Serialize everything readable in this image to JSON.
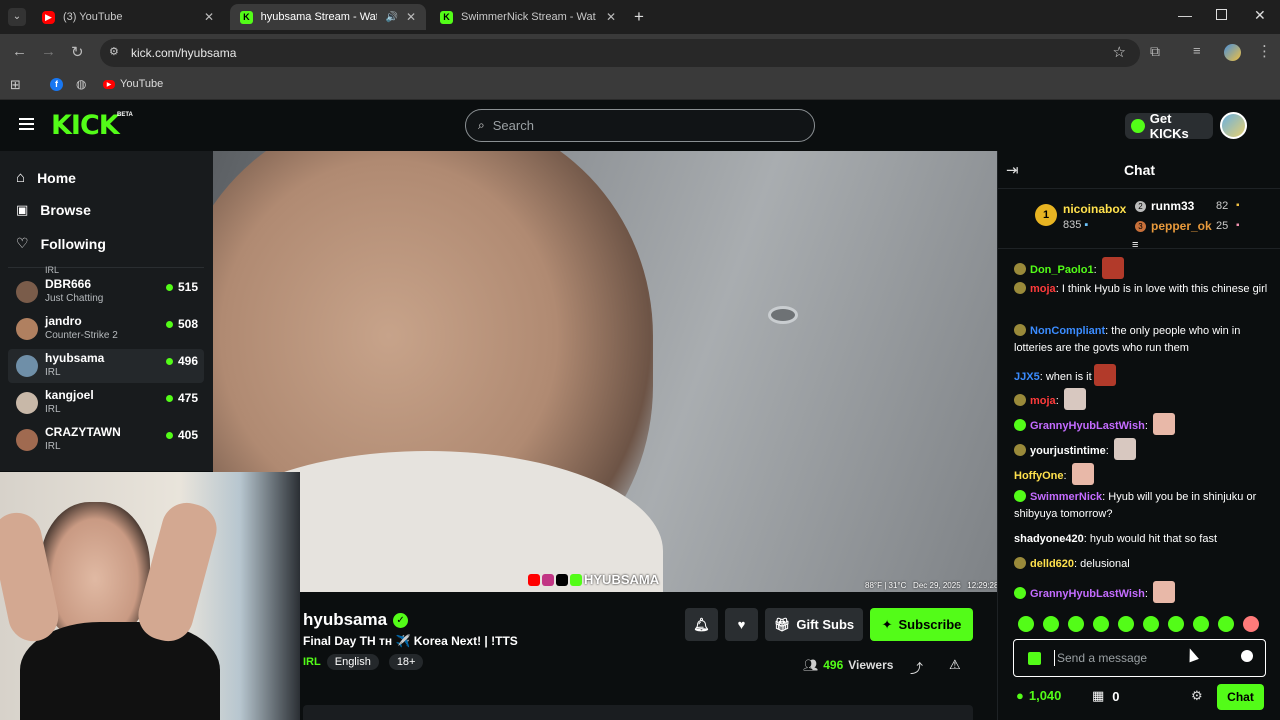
{
  "browser": {
    "tabs": [
      {
        "title": "(3) YouTube",
        "active": false
      },
      {
        "title": "hyubsama Stream - Watch L",
        "active": true
      },
      {
        "title": "SwimmerNick Stream - Watch L",
        "active": false
      }
    ],
    "url": "kick.com/hyubsama",
    "bookmarks": [
      {
        "label": "YouTube"
      }
    ]
  },
  "header": {
    "logo": "KICK",
    "beta": "BETA",
    "search_placeholder": "Search",
    "get_kicks": "Get KICKs"
  },
  "sidebar": {
    "nav": [
      {
        "label": "Home",
        "icon": "home-icon"
      },
      {
        "label": "Browse",
        "icon": "browse-icon"
      },
      {
        "label": "Following",
        "icon": "heart-icon"
      }
    ],
    "partial_top": "IRL",
    "channels": [
      {
        "name": "DBR666",
        "category": "Just Chatting",
        "viewers": "515",
        "active": false,
        "avatar": "#7a5c4a"
      },
      {
        "name": "jandro",
        "category": "Counter-Strike 2",
        "viewers": "508",
        "active": false,
        "avatar": "#b08060"
      },
      {
        "name": "hyubsama",
        "category": "IRL",
        "viewers": "496",
        "active": true,
        "avatar": "#6f8fa8"
      },
      {
        "name": "kangjoel",
        "category": "IRL",
        "viewers": "475",
        "active": false,
        "avatar": "#c8b8a8"
      },
      {
        "name": "CRAZYTAWN",
        "category": "IRL",
        "viewers": "405",
        "active": false,
        "avatar": "#a06a50"
      }
    ]
  },
  "video": {
    "watermark": "HYUBSAMA",
    "overlay_info": "88°F | 31°C   Dec 29, 2025   12:29:28"
  },
  "stream": {
    "channel": "hyubsama",
    "title": "Final Day TH ᴛʜ ✈️ Korea Next! | !TTS",
    "category": "IRL",
    "tags": [
      "English",
      "18+"
    ],
    "viewers_count": "496",
    "viewers_label": "Viewers",
    "gift_subs": "Gift Subs",
    "subscribe": "Subscribe"
  },
  "chat": {
    "title": "Chat",
    "leaderboard": {
      "first": {
        "rank": "1",
        "name": "nicoinabox",
        "score": "835"
      },
      "second": {
        "rank": "2",
        "name": "runm33",
        "score": "82"
      },
      "third": {
        "rank": "3",
        "name": "pepper_ok",
        "score": "25"
      }
    },
    "messages": [
      {
        "user": "Don_Paolo1",
        "color": "#53fc18",
        "text": "",
        "emote": "#b23a2a",
        "badge": "#9a8a3a"
      },
      {
        "user": "moja",
        "color": "#ff3b3b",
        "text": "I think Hyub is in love with this chinese girl",
        "emote": "",
        "badge": "#9a8a3a"
      },
      {
        "user": "NonCompliant",
        "color": "#3b8cff",
        "text": "the only people who win in lotteries are the govts who run them",
        "emote": "",
        "badge": "#9a8a3a"
      },
      {
        "user": "JJX5",
        "color": "#3b8cff",
        "text": "when is it",
        "emote": "#b23a2a",
        "badge": ""
      },
      {
        "user": "moja",
        "color": "#ff3b3b",
        "text": "",
        "emote": "#d8c8c0",
        "badge": "#9a8a3a"
      },
      {
        "user": "GrannyHyubLastWish",
        "color": "#c46cff",
        "text": "",
        "emote": "#e8b8a8",
        "badge": "#53fc18"
      },
      {
        "user": "yourjustintime",
        "color": "#ffffff",
        "text": "",
        "emote": "#d8c8c0",
        "badge": "#9a8a3a"
      },
      {
        "user": "HoffyOne",
        "color": "#ffe14d",
        "text": "",
        "emote": "#e8b8a8",
        "badge": ""
      },
      {
        "user": "SwimmerNick",
        "color": "#c46cff",
        "text": "Hyub will you be in shinjuku or shibyuya tomorrow?",
        "emote": "",
        "badge": "#53fc18"
      },
      {
        "user": "shadyone420",
        "color": "#ffffff",
        "text": "hyub would hit that so fast",
        "emote": "",
        "badge": ""
      },
      {
        "user": "delld620",
        "color": "#ffe14d",
        "text": "delusional",
        "emote": "",
        "badge": "#9a8a3a"
      },
      {
        "user": "GrannyHyubLastWish",
        "color": "#c46cff",
        "text": "",
        "emote": "#e8b8a8",
        "badge": "#53fc18"
      }
    ],
    "input_placeholder": "Send a message",
    "kicks_balance": "1,040",
    "gifts_count": "0",
    "send_label": "Chat"
  },
  "colors": {
    "accent": "#53fc18",
    "bg": "#0b0e0f",
    "panel": "#181b1d"
  }
}
